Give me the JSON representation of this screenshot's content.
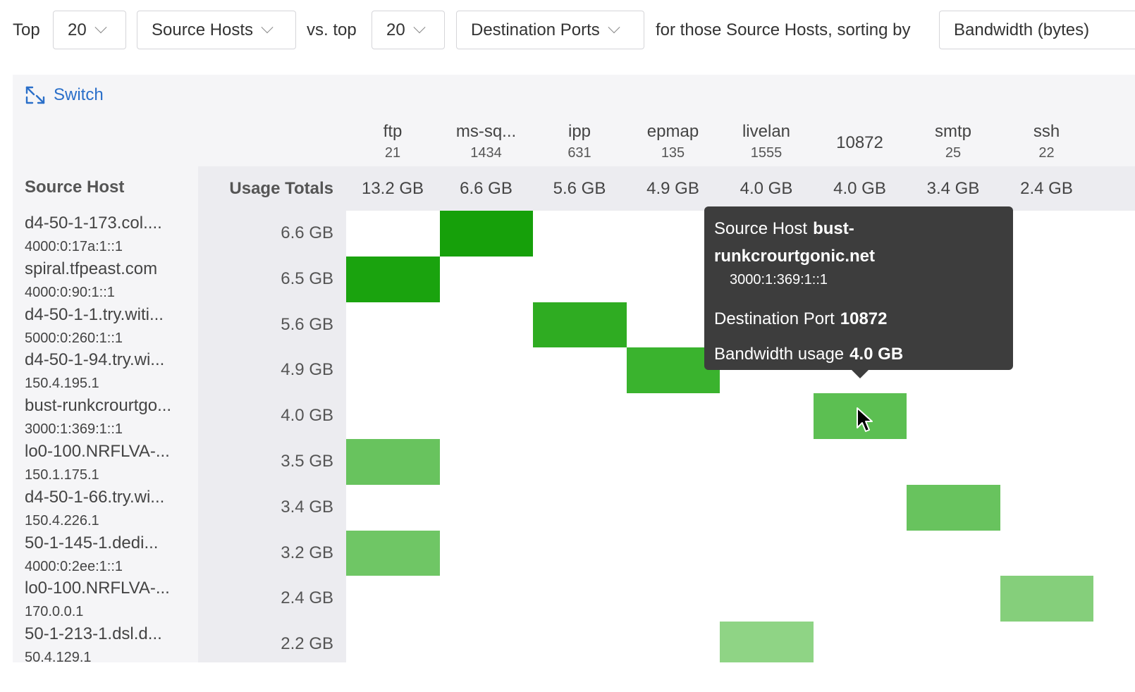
{
  "controls": {
    "label_top": "Top",
    "top_count": "20",
    "dimension_1": "Source Hosts",
    "label_vs": "vs. top",
    "vs_count": "20",
    "dimension_2": "Destination Ports",
    "label_sorting": "for those Source Hosts, sorting by",
    "sort_by": "Bandwidth (bytes)"
  },
  "panel": {
    "switch_label": "Switch",
    "source_host_header": "Source Host",
    "usage_totals_header": "Usage Totals"
  },
  "columns": [
    {
      "name": "ftp",
      "port": "21",
      "total": "13.2 GB"
    },
    {
      "name": "ms-sq...",
      "port": "1434",
      "total": "6.6 GB"
    },
    {
      "name": "ipp",
      "port": "631",
      "total": "5.6 GB"
    },
    {
      "name": "epmap",
      "port": "135",
      "total": "4.9 GB"
    },
    {
      "name": "livelan",
      "port": "1555",
      "total": "4.0 GB"
    },
    {
      "name": "10872",
      "port": "",
      "total": "4.0 GB"
    },
    {
      "name": "smtp",
      "port": "25",
      "total": "3.4 GB"
    },
    {
      "name": "ssh",
      "port": "22",
      "total": "2.4 GB"
    }
  ],
  "rows": [
    {
      "host": "d4-50-1-173.col....",
      "ip": "4000:0:17a:1::1",
      "usage": "6.6 GB"
    },
    {
      "host": "spiral.tfpeast.com",
      "ip": "4000:0:90:1::1",
      "usage": "6.5 GB"
    },
    {
      "host": "d4-50-1-1.try.witi...",
      "ip": "5000:0:260:1::1",
      "usage": "5.6 GB"
    },
    {
      "host": "d4-50-1-94.try.wi...",
      "ip": "150.4.195.1",
      "usage": "4.9 GB"
    },
    {
      "host": "bust-runkcrourtgo...",
      "ip": "3000:1:369:1::1",
      "usage": "4.0 GB"
    },
    {
      "host": "lo0-100.NRFLVA-...",
      "ip": "150.1.175.1",
      "usage": "3.5 GB"
    },
    {
      "host": "d4-50-1-66.try.wi...",
      "ip": "150.4.226.1",
      "usage": "3.4 GB"
    },
    {
      "host": "50-1-145-1.dedi...",
      "ip": "4000:0:2ee:1::1",
      "usage": "3.2 GB"
    },
    {
      "host": "lo0-100.NRFLVA-...",
      "ip": "170.0.0.1",
      "usage": "2.4 GB"
    },
    {
      "host": "50-1-213-1.dsl.d...",
      "ip": "50.4.129.1",
      "usage": "2.2 GB"
    }
  ],
  "cells": [
    {
      "row": 0,
      "col": 1,
      "color": "#16a00a"
    },
    {
      "row": 1,
      "col": 0,
      "color": "#1aa30e"
    },
    {
      "row": 2,
      "col": 2,
      "color": "#2fac22"
    },
    {
      "row": 3,
      "col": 3,
      "color": "#3ab32e"
    },
    {
      "row": 4,
      "col": 5,
      "color": "#5cbf52"
    },
    {
      "row": 5,
      "col": 0,
      "color": "#68c35e"
    },
    {
      "row": 6,
      "col": 6,
      "color": "#68c35e"
    },
    {
      "row": 7,
      "col": 0,
      "color": "#6fc665"
    },
    {
      "row": 8,
      "col": 7,
      "color": "#85cf7b"
    },
    {
      "row": 9,
      "col": 4,
      "color": "#8fd485"
    }
  ],
  "tooltip": {
    "source_host_label": "Source Host",
    "source_host_value_1": "bust-",
    "source_host_value_2": "runkcrourtgonic.net",
    "source_ip": "3000:1:369:1::1",
    "port_label": "Destination Port",
    "port_value": "10872",
    "bandwidth_label": "Bandwidth usage",
    "bandwidth_value": "4.0 GB"
  }
}
